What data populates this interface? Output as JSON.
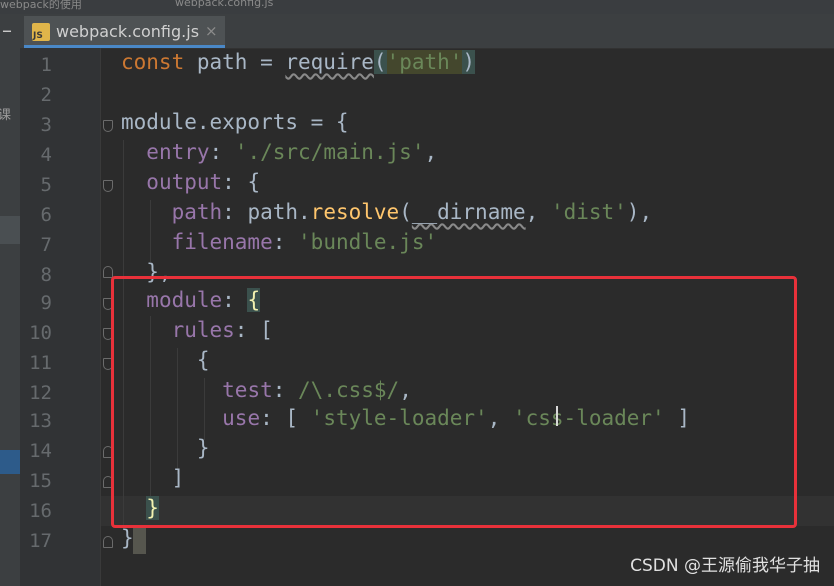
{
  "breadcrumb": {
    "left": "webpack的使用",
    "right": "webpack.config.js"
  },
  "tab": {
    "icon_label": "JS",
    "title": "webpack.config.js",
    "close": "×"
  },
  "sidebar": {
    "label": "课"
  },
  "editor": {
    "line_numbers": [
      "1",
      "2",
      "3",
      "4",
      "5",
      "6",
      "7",
      "8",
      "9",
      "10",
      "11",
      "12",
      "13",
      "14",
      "15",
      "16",
      "17"
    ],
    "tokens": {
      "const": "const",
      "path": " path = ",
      "require": "require",
      "paren_open": "(",
      "path_str": "'path'",
      "paren_close": ")",
      "module": "module",
      "exports": ".exports = {",
      "entry_key": "entry",
      "entry_sep": ": ",
      "entry_val": "'./src/main.js'",
      "comma": ",",
      "output_key": "output",
      "output_rest": ": {",
      "path_key": "path",
      "path_mid": ": path.",
      "resolve": "resolve",
      "resolve_open": "(",
      "dirname": "__dirname",
      "arg_sep": ", ",
      "dist_str": "'dist'",
      "resolve_close": "),",
      "filename_key": "filename",
      "filename_sep": ": ",
      "filename_val": "'bundle.js'",
      "close_brace_comma": "},",
      "module_key": "module",
      "module_sep": ": ",
      "brace_open": "{",
      "rules_key": "rules",
      "rules_rest": ": [",
      "obj_open": "{",
      "test_key": "test",
      "test_sep": ": ",
      "regex": "/\\.css$/",
      "test_comma": ",",
      "use_key": "use",
      "use_open": ": [ ",
      "style_loader": "'style-loader'",
      "use_sep": ", ",
      "css_loader": "'css-loader'",
      "use_close": " ]",
      "obj_close": "}",
      "arr_close": "]",
      "brace_close": "}",
      "final_close": "}"
    }
  },
  "watermark": "CSDN @王源偷我华子抽",
  "colors": {
    "background": "#2b2b2b",
    "keyword": "#cc7832",
    "property": "#9876aa",
    "string": "#6a8759",
    "function": "#ffc66d",
    "highlight_box": "#e8313a"
  }
}
